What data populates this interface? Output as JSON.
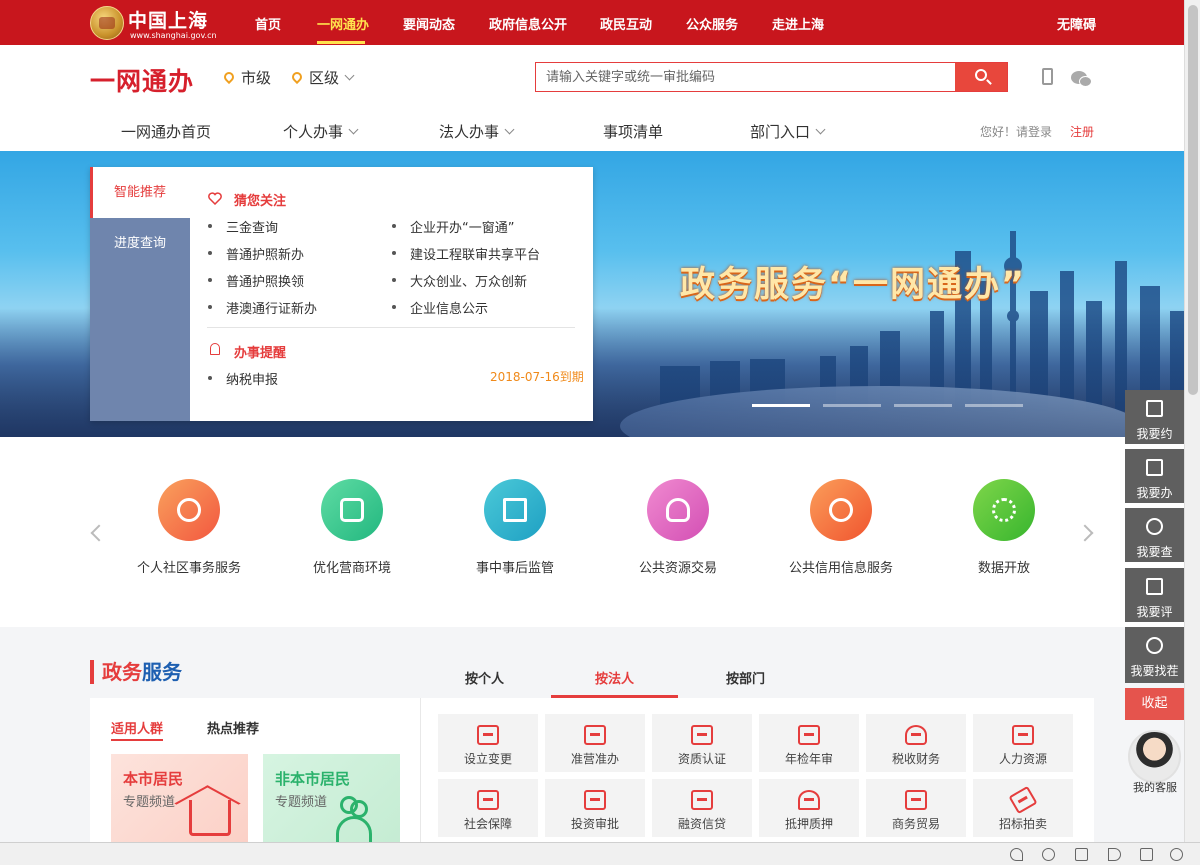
{
  "top": {
    "logo_name": "中国上海",
    "logo_url": "www.shanghai.gov.cn",
    "nav": [
      "首页",
      "一网通办",
      "要闻动态",
      "政府信息公开",
      "政民互动",
      "公众服务",
      "走进上海"
    ],
    "accessible": "无障碍"
  },
  "header": {
    "brand": "一网通办",
    "city": "市级",
    "district": "区级",
    "search_placeholder": "请输入关键字或统一审批编码",
    "nav": [
      "一网通办首页",
      "个人办事",
      "法人办事",
      "事项清单",
      "部门入口"
    ],
    "login": "您好！请登录",
    "register": "注册"
  },
  "banner": {
    "slogan": "政务服务“一网通办”",
    "tabs": [
      "智能推荐",
      "进度查询"
    ],
    "guess_title": "猜您关注",
    "guess_left": [
      "三金查询",
      "普通护照新办",
      "普通护照换领",
      "港澳通行证新办"
    ],
    "guess_right": [
      "企业开办“一窗通”",
      "建设工程联审共享平台",
      "大众创业、万众创新",
      "企业信息公示"
    ],
    "remind_title": "办事提醒",
    "remind_item": "纳税申报",
    "remind_date": "2018-07-16到期"
  },
  "services": [
    {
      "label": "个人社区事务服务",
      "color": "#f26b4c"
    },
    {
      "label": "优化营商环境",
      "color": "#2fc190"
    },
    {
      "label": "事中事后监管",
      "color": "#2ab0c8"
    },
    {
      "label": "公共资源交易",
      "color": "#e85aa6"
    },
    {
      "label": "公共信用信息服务",
      "color": "#f06d3c"
    },
    {
      "label": "数据开放",
      "color": "#4cbf3a"
    }
  ],
  "gov": {
    "title_a": "政务",
    "title_b": "服务",
    "tabs": [
      "按个人",
      "按法人",
      "按部门"
    ],
    "subtabs": [
      "适用人群",
      "热点推荐"
    ],
    "card1_title": "本市居民",
    "card1_sub": "专题频道",
    "card2_title": "非本市居民",
    "card2_sub": "专题频道",
    "items": [
      "设立变更",
      "准营准办",
      "资质认证",
      "年检年审",
      "税收财务",
      "人力资源",
      "社会保障",
      "投资审批",
      "融资信贷",
      "抵押质押",
      "商务贸易",
      "招标拍卖"
    ]
  },
  "float": {
    "items": [
      "我要约",
      "我要办",
      "我要查",
      "我要评",
      "我要找茬"
    ],
    "collapse": "收起",
    "service": "我的客服"
  }
}
